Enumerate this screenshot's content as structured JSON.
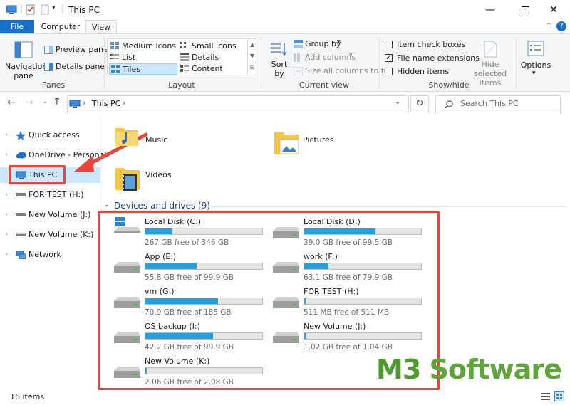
{
  "window": {
    "title": "This PC"
  },
  "ribbon_tabs": [
    {
      "label": "File"
    },
    {
      "label": "Computer"
    },
    {
      "label": "View"
    }
  ],
  "ribbon": {
    "panes": {
      "navigation_pane": "Navigation pane",
      "preview_pane": "Preview pane",
      "details_pane": "Details pane",
      "group_label": "Panes"
    },
    "layout": {
      "items": [
        "Medium icons",
        "Small icons",
        "List",
        "Details",
        "Tiles",
        "Content"
      ],
      "selected": "Tiles",
      "group_label": "Layout"
    },
    "current_view": {
      "sort_by": "Sort by",
      "group_by": "Group by",
      "add_columns": "Add columns",
      "size_all_columns": "Size all columns to fit",
      "group_label": "Current view"
    },
    "show_hide": {
      "item_check_boxes": "Item check boxes",
      "file_name_extensions": "File name extensions",
      "hidden_items": "Hidden items",
      "item_check_boxes_checked": false,
      "file_name_extensions_checked": true,
      "hidden_items_checked": false,
      "hide_selected_items": "Hide selected items",
      "group_label": "Show/hide"
    },
    "options": "Options"
  },
  "address": {
    "path": "This PC",
    "search_placeholder": "Search This PC"
  },
  "sidebar": {
    "items": [
      {
        "label": "Quick access",
        "icon": "star-icon"
      },
      {
        "label": "OneDrive - Personal",
        "icon": "cloud-icon"
      },
      {
        "label": "This PC",
        "icon": "computer-icon"
      },
      {
        "label": "FOR TEST (H:)",
        "icon": "usb-drive-icon"
      },
      {
        "label": "New Volume (J:)",
        "icon": "drive-icon"
      },
      {
        "label": "New Volume (K:)",
        "icon": "drive-icon"
      },
      {
        "label": "Network",
        "icon": "network-icon"
      }
    ]
  },
  "folders": [
    {
      "label": "Music"
    },
    {
      "label": "Pictures"
    },
    {
      "label": "Videos"
    }
  ],
  "devices": {
    "header": "Devices and drives (9)",
    "drives": [
      {
        "name": "Local Disk (C:)",
        "free": "267 GB free of 346 GB",
        "used_fraction": 0.23,
        "icon": "windows-drive-icon"
      },
      {
        "name": "Local Disk (D:)",
        "free": "39.0 GB free of 99.5 GB",
        "used_fraction": 0.61,
        "icon": "drive-icon"
      },
      {
        "name": "App (E:)",
        "free": "55.8 GB free of 99.9 GB",
        "used_fraction": 0.44,
        "icon": "drive-icon"
      },
      {
        "name": "work (F:)",
        "free": "63.1 GB free of 79.9 GB",
        "used_fraction": 0.21,
        "icon": "drive-icon"
      },
      {
        "name": "vm (G:)",
        "free": "70.9 GB free of 185 GB",
        "used_fraction": 0.62,
        "icon": "drive-icon"
      },
      {
        "name": "FOR TEST (H:)",
        "free": "511 MB free of 511 MB",
        "used_fraction": 0.0,
        "icon": "drive-icon"
      },
      {
        "name": "OS backup (I:)",
        "free": "42.2 GB free of 99.9 GB",
        "used_fraction": 0.58,
        "icon": "drive-icon"
      },
      {
        "name": "New Volume (J:)",
        "free": "1.02 GB free of 1.04 GB",
        "used_fraction": 0.02,
        "icon": "drive-icon"
      },
      {
        "name": "New Volume (K:)",
        "free": "2.06 GB free of 2.08 GB",
        "used_fraction": 0.01,
        "icon": "drive-icon"
      }
    ]
  },
  "status": {
    "items": "16 items"
  },
  "watermark": {
    "prefix": "M3",
    "suffix": " Software"
  },
  "colors": {
    "accent": "#1a6fc9",
    "progress": "#26a0da",
    "highlight": "#e8453c",
    "selection": "#cce8ff"
  }
}
